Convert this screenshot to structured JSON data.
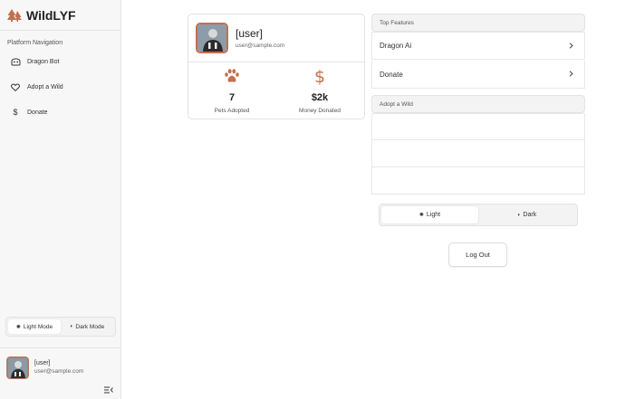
{
  "brand": {
    "name": "WildLYF",
    "color": "#c2714f"
  },
  "sidebar": {
    "section_title": "Platform Navigation",
    "items": [
      {
        "label": "Dragon Bot",
        "icon": "bot-icon"
      },
      {
        "label": "Adopt a Wild",
        "icon": "heart-icon"
      },
      {
        "label": "Donate",
        "icon": "dollar-icon"
      }
    ],
    "mode_toggle": {
      "light": "Light Mode",
      "dark": "Dark Mode",
      "selected": "light"
    },
    "user": {
      "name": "[user]",
      "email": "user@sample.com"
    }
  },
  "profile": {
    "name": "[user]",
    "email": "user@sample.com",
    "stats": [
      {
        "value": "7",
        "label": "Pets Adopted",
        "icon": "paw-icon"
      },
      {
        "value": "$2k",
        "label": "Money Donated",
        "icon": "dollar-icon"
      }
    ]
  },
  "features": {
    "title": "Top Features",
    "items": [
      {
        "label": "Dragon Ai"
      },
      {
        "label": "Donate"
      }
    ]
  },
  "adopt": {
    "title": "Adopt a Wild"
  },
  "theme": {
    "light": "Light",
    "dark": "Dark",
    "selected": "light"
  },
  "logout_label": "Log Out"
}
